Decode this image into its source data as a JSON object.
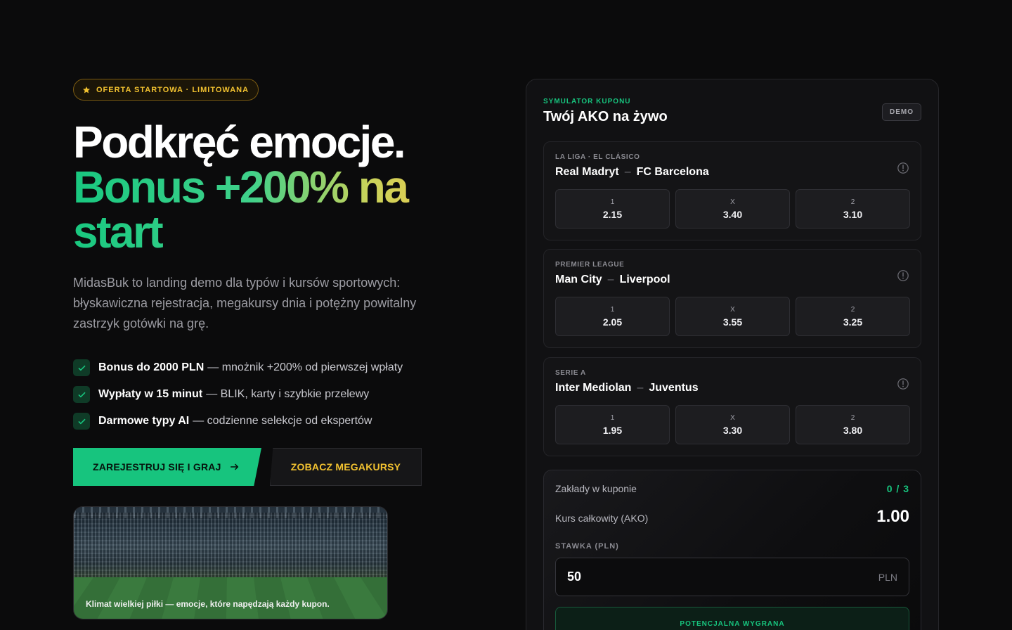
{
  "hero": {
    "badge": "OFERTA STARTOWA · LIMITOWANA",
    "title_line1": "Podkręć emocje.",
    "title_line2": "Bonus +200% na start",
    "description": "MidasBuk to landing demo dla typów i kursów sportowych: błyskawiczna rejestracja, megakursy dnia i potężny powitalny zastrzyk gotówki na grę.",
    "features": [
      {
        "bold": "Bonus do 2000 PLN",
        "text": "— mnożnik +200% od pierwszej wpłaty"
      },
      {
        "bold": "Wypłaty w 15 minut",
        "text": "— BLIK, karty i szybkie przelewy"
      },
      {
        "bold": "Darmowe typy AI",
        "text": "— codzienne selekcje od ekspertów"
      }
    ],
    "cta_primary": "ZAREJESTRUJ SIĘ I GRAJ",
    "cta_secondary": "ZOBACZ MEGAKURSY",
    "image_caption": "Klimat wielkiej piłki — emocje, które napędzają każdy kupon."
  },
  "simulator": {
    "label": "SYMULATOR KUPONU",
    "title": "Twój AKO na żywo",
    "badge": "DEMO",
    "matches": [
      {
        "league": "LA LIGA · EL CLÁSICO",
        "home": "Real Madryt",
        "away": "FC Barcelona",
        "odds": [
          {
            "label": "1",
            "value": "2.15"
          },
          {
            "label": "X",
            "value": "3.40"
          },
          {
            "label": "2",
            "value": "3.10"
          }
        ]
      },
      {
        "league": "PREMIER LEAGUE",
        "home": "Man City",
        "away": "Liverpool",
        "odds": [
          {
            "label": "1",
            "value": "2.05"
          },
          {
            "label": "X",
            "value": "3.55"
          },
          {
            "label": "2",
            "value": "3.25"
          }
        ]
      },
      {
        "league": "SERIE A",
        "home": "Inter Mediolan",
        "away": "Juventus",
        "odds": [
          {
            "label": "1",
            "value": "1.95"
          },
          {
            "label": "X",
            "value": "3.30"
          },
          {
            "label": "2",
            "value": "3.80"
          }
        ]
      }
    ],
    "coupon": {
      "bets_label": "Zakłady w kuponie",
      "bets_count": "0 / 3",
      "total_label": "Kurs całkowity (AKO)",
      "total_value": "1.00",
      "stake_label": "STAWKA (PLN)",
      "stake_value": "50",
      "stake_unit": "PLN",
      "win_label": "POTENCJALNA WYGRANA"
    }
  },
  "colors": {
    "accent": "#17c47e",
    "gold": "#f2c230",
    "background": "#0b0b0c"
  }
}
